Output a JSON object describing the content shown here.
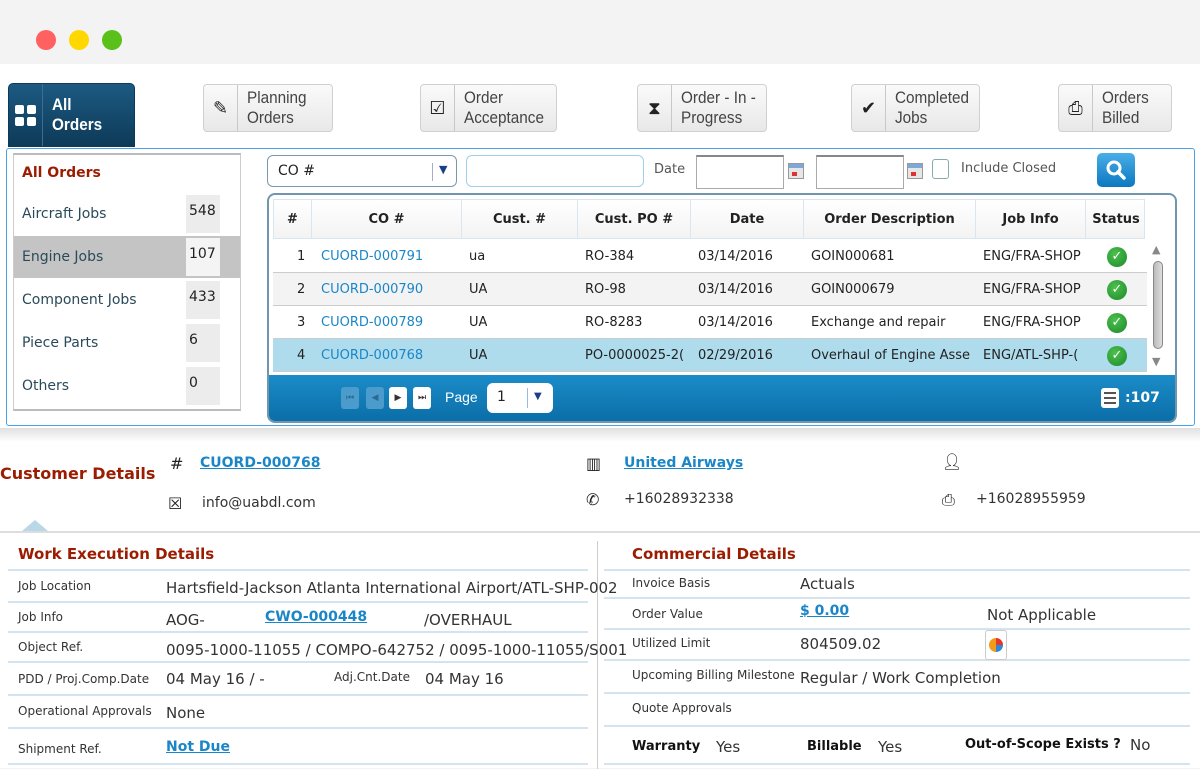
{
  "window": {
    "controls": [
      "close",
      "minimize",
      "maximize"
    ]
  },
  "tabs": [
    {
      "label_line1": "All Orders",
      "label_line2": "",
      "icon": "grid-icon",
      "active": true
    },
    {
      "label_line1": "Planning",
      "label_line2": "Orders",
      "icon": "edit-icon",
      "active": false
    },
    {
      "label_line1": "Order",
      "label_line2": "Acceptance",
      "icon": "checkbox-icon",
      "active": false
    },
    {
      "label_line1": "Order - In -",
      "label_line2": "Progress",
      "icon": "hourglass-icon",
      "active": false
    },
    {
      "label_line1": "Completed",
      "label_line2": "Jobs",
      "icon": "checkmark-icon",
      "active": false
    },
    {
      "label_line1": "Orders",
      "label_line2": "Billed",
      "icon": "printer-icon",
      "active": false
    }
  ],
  "categories": {
    "title": "All Orders",
    "items": [
      {
        "name": "Aircraft Jobs",
        "count": "548"
      },
      {
        "name": "Engine Jobs",
        "count": "107",
        "selected": true
      },
      {
        "name": "Component Jobs",
        "count": "433"
      },
      {
        "name": "Piece Parts",
        "count": "6"
      },
      {
        "name": "Others",
        "count": "0"
      }
    ]
  },
  "filters": {
    "field_select": "CO #",
    "search_value": "",
    "date_label": "Date",
    "date_from": "",
    "date_to": "",
    "include_closed_label": "Include Closed",
    "include_closed": false
  },
  "table": {
    "columns": [
      "#",
      "CO #",
      "Cust. #",
      "Cust. PO #",
      "Date",
      "Order Description",
      "Job Info",
      "Status"
    ],
    "rows": [
      {
        "n": "1",
        "co": "CUORD-000791",
        "cust": "ua",
        "po": "RO-384",
        "date": "03/14/2016",
        "desc": "GOIN000681",
        "job": "ENG/FRA-SHOP",
        "status": "ok"
      },
      {
        "n": "2",
        "co": "CUORD-000790",
        "cust": "UA",
        "po": "RO-98",
        "date": "03/14/2016",
        "desc": "GOIN000679",
        "job": "ENG/FRA-SHOP",
        "status": "ok"
      },
      {
        "n": "3",
        "co": "CUORD-000789",
        "cust": "UA",
        "po": "RO-8283",
        "date": "03/14/2016",
        "desc": "Exchange and repair",
        "job": "ENG/FRA-SHOP",
        "status": "ok"
      },
      {
        "n": "4",
        "co": "CUORD-000768",
        "cust": "UA",
        "po": "PO-0000025-2(",
        "date": "02/29/2016",
        "desc": "Overhaul of Engine Asse",
        "job": "ENG/ATL-SHP-(",
        "status": "ok",
        "selected": true
      }
    ],
    "status_check": "✓"
  },
  "pager": {
    "page_label": "Page",
    "page": "1",
    "total": ":107"
  },
  "customer": {
    "title": "Customer Details",
    "order_no": "CUORD-000768",
    "company": "United Airways",
    "contact": "",
    "email": "info@uabdl.com",
    "phone": "+16028932338",
    "fax": "+16028955959"
  },
  "work": {
    "title": "Work Execution Details",
    "job_location_label": "Job Location",
    "job_location": "Hartsfield-Jackson Atlanta International Airport/ATL-SHP-002",
    "job_info_label": "Job Info",
    "job_info_prefix": "AOG-",
    "job_info_link": "CWO-000448",
    "job_info_suffix": "/OVERHAUL",
    "object_ref_label": "Object Ref.",
    "object_ref": "0095-1000-11055 / COMPO-642752 / 0095-1000-11055/S001",
    "pdd_label": "PDD / Proj.Comp.Date",
    "pdd": "04 May 16 / -",
    "adj_label": "Adj.Cnt.Date",
    "adj": "04 May 16",
    "op_approvals_label": "Operational Approvals",
    "op_approvals": "None",
    "shipment_label": "Shipment Ref.",
    "shipment": "Not Due"
  },
  "commercial": {
    "title": "Commercial Details",
    "invoice_basis_label": "Invoice Basis",
    "invoice_basis": "Actuals",
    "order_value_label": "Order Value",
    "order_value": "$ 0.00",
    "order_value_note": "Not Applicable",
    "utilized_limit_label": "Utilized Limit",
    "utilized_limit": "804509.02",
    "billing_milestone_label": "Upcoming Billing Milestone",
    "billing_milestone": "Regular / Work Completion",
    "quote_approvals_label": "Quote Approvals",
    "quote_approvals": "",
    "warranty_label": "Warranty",
    "warranty": "Yes",
    "billable_label": "Billable",
    "billable": "Yes",
    "out_of_scope_label": "Out-of-Scope Exists ?",
    "out_of_scope": "No"
  },
  "colors": {
    "accent": "#1a86c8",
    "header_dark": "#0e3a58",
    "section_title": "#9b1c00",
    "selected_row": "#aedcec",
    "status_ok": "#1a8a2a"
  }
}
